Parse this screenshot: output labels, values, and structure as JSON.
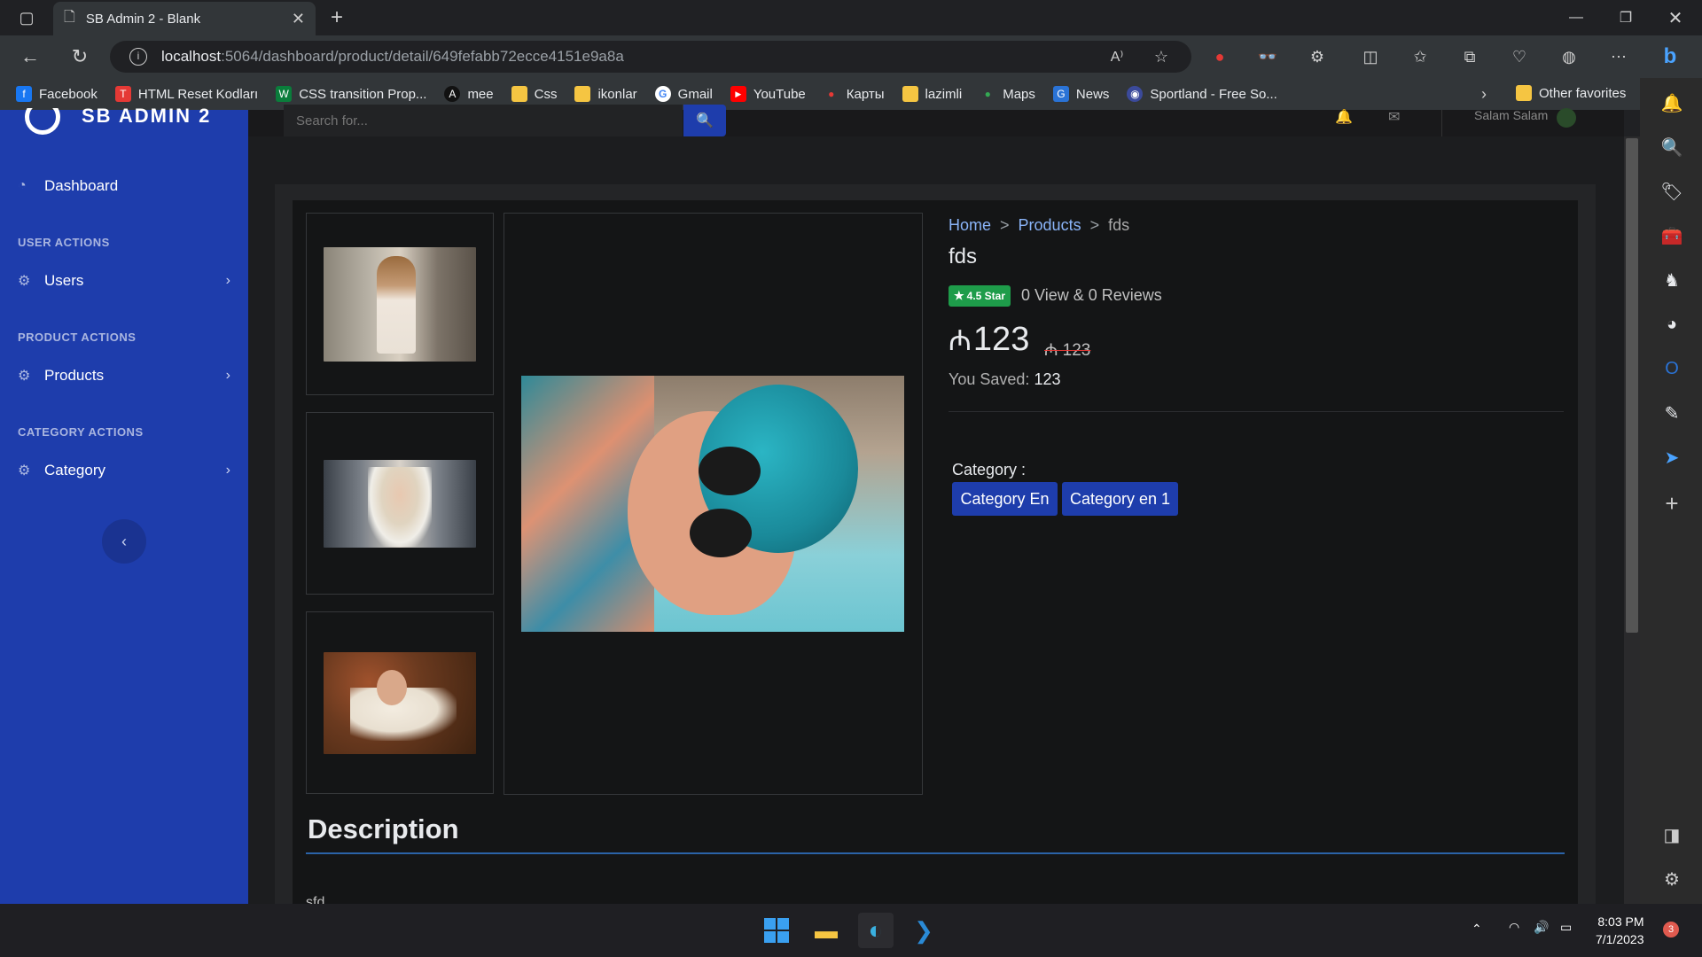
{
  "browser": {
    "tab_title": "SB Admin 2 - Blank",
    "url_host": "localhost",
    "url_rest": ":5064/dashboard/product/detail/649fefabb72ecce4151e9a8a",
    "bookmarks": [
      {
        "label": "Facebook",
        "color": "#1877f2",
        "glyph": "f"
      },
      {
        "label": "HTML Reset Kodları",
        "color": "#e53935",
        "glyph": "T"
      },
      {
        "label": "CSS transition Prop...",
        "color": "#0a7d3b",
        "glyph": "W"
      },
      {
        "label": "mee",
        "color": "#111111",
        "glyph": "A"
      },
      {
        "label": "Css",
        "color": "#f5c542",
        "glyph": ""
      },
      {
        "label": "ikonlar",
        "color": "#f5c542",
        "glyph": ""
      },
      {
        "label": "Gmail",
        "color": "#ffffff",
        "glyph": "G"
      },
      {
        "label": "YouTube",
        "color": "#ff0000",
        "glyph": "▶"
      },
      {
        "label": "Карты",
        "color": "#e53935",
        "glyph": "●"
      },
      {
        "label": "lazimli",
        "color": "#f5c542",
        "glyph": ""
      },
      {
        "label": "Maps",
        "color": "#34a853",
        "glyph": "●"
      },
      {
        "label": "News",
        "color": "#2a73d6",
        "glyph": "G"
      },
      {
        "label": "Sportland - Free So...",
        "color": "#3b4a9b",
        "glyph": "◉"
      }
    ],
    "other_favorites": "Other favorites"
  },
  "app": {
    "brand": "SB ADMIN 2",
    "search_placeholder": "Search for...",
    "user_name": "Salam Salam",
    "nav": {
      "dashboard": "Dashboard",
      "user_actions": "USER ACTIONS",
      "users": "Users",
      "product_actions": "PRODUCT ACTIONS",
      "products": "Products",
      "category_actions": "CATEGORY ACTIONS",
      "category": "Category"
    }
  },
  "product": {
    "breadcrumb": {
      "home": "Home",
      "products": "Products",
      "current": "fds",
      "sep": ">"
    },
    "title": "fds",
    "rating_badge": "4.5 Star",
    "reviews": "0 View & 0 Reviews",
    "price": "123",
    "currency": "₼",
    "old_price": "₼ 123",
    "saved_label": "You Saved:",
    "saved_value": "123",
    "category_label": "Category :",
    "categories": [
      "Category En",
      "Category en 1"
    ],
    "description_title": "Description",
    "description_text": "sfd"
  },
  "taskbar": {
    "time": "8:03 PM",
    "date": "7/1/2023",
    "notif_count": "3"
  },
  "colors": {
    "sidebar": "#1e3dac",
    "accent": "#1e3dac",
    "badge_green": "#1e9c4a",
    "link": "#8ab4f8"
  }
}
